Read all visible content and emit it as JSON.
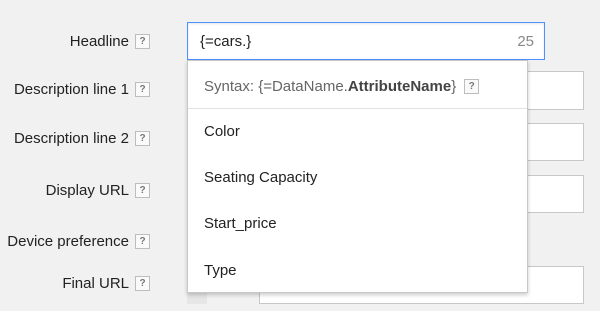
{
  "form": {
    "fields": [
      {
        "label": "Headline",
        "help": "?"
      },
      {
        "label": "Description line 1",
        "help": "?"
      },
      {
        "label": "Description line 2",
        "help": "?"
      },
      {
        "label": "Display URL",
        "help": "?"
      },
      {
        "label": "Device preference",
        "help": "?"
      },
      {
        "label": "Final URL",
        "help": "?"
      }
    ],
    "headline_value": "{=cars.}",
    "headline_count": "25"
  },
  "dropdown": {
    "syntax_prefix": "Syntax: {=DataName.",
    "syntax_bold": "AttributeName",
    "syntax_suffix": "}",
    "help": "?",
    "options": [
      "Color",
      "Seating Capacity",
      "Start_price",
      "Type"
    ]
  },
  "colors": {
    "focus_border": "#4d90fe",
    "background": "#f1f1f1"
  }
}
